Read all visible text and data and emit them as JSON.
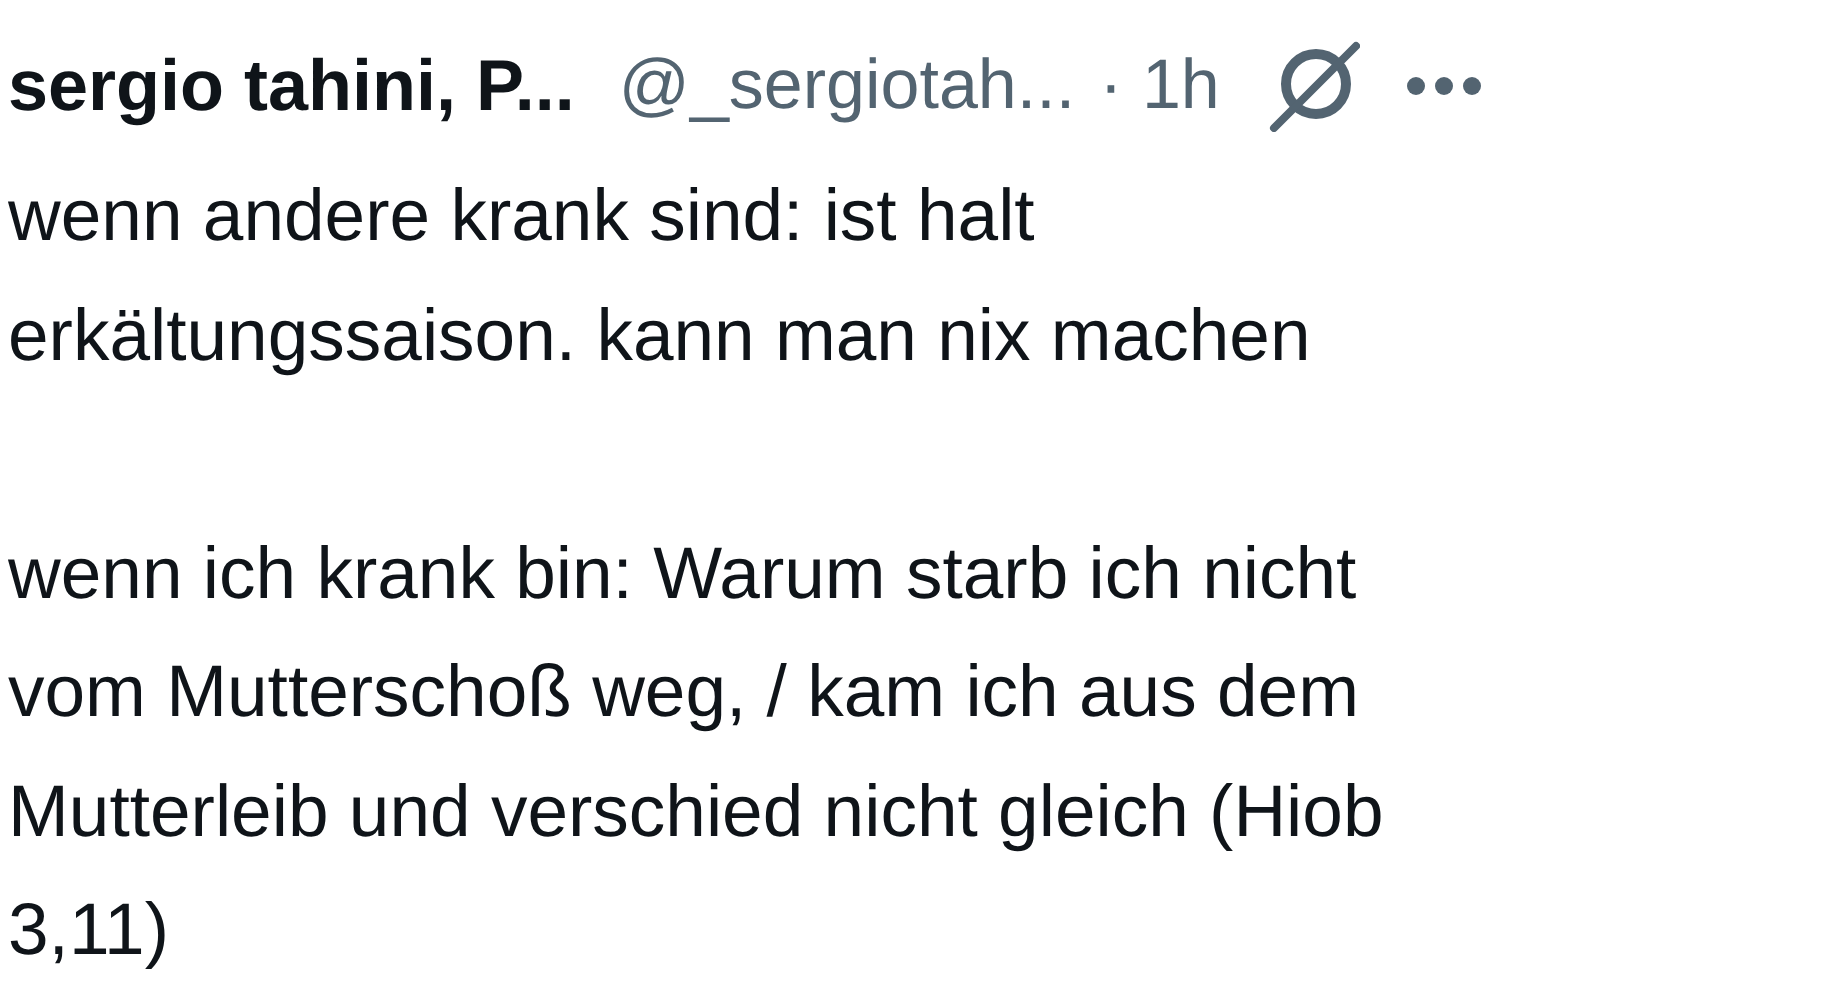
{
  "post": {
    "author_name": "sergio tahini, P...",
    "handle": "@_sergiotah...",
    "time": "· 1h",
    "text": "wenn andere krank sind: ist halt\nerkältungssaison. kann man nix machen\n\nwenn ich krank bin: Warum starb ich nicht\nvom Mutterschoß weg, / kam ich aus dem\nMutterleib und verschied nicht gleich (Hiob\n3,11)"
  }
}
